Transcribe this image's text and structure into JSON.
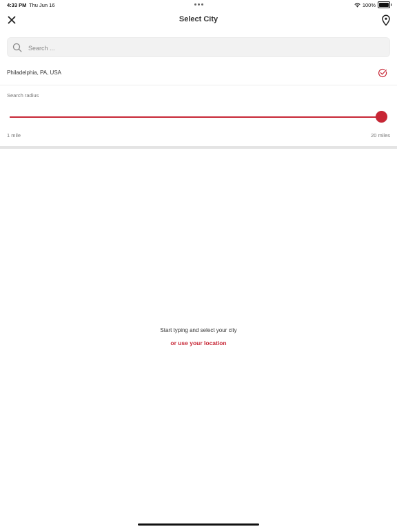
{
  "status_bar": {
    "time": "4:33 PM",
    "date": "Thu Jun 16",
    "battery": "100%"
  },
  "header": {
    "title": "Select City",
    "close_icon": "close-icon",
    "location_icon": "location-pin-icon"
  },
  "search": {
    "placeholder": "Search ...",
    "value": "",
    "icon": "search-icon"
  },
  "selected_city": {
    "name": "Philadelphia, PA, USA",
    "selected": true,
    "icon": "check-circle-icon"
  },
  "radius": {
    "label": "Search radius",
    "min_label": "1 mile",
    "max_label": "20 miles",
    "min": 1,
    "max": 20,
    "value": 20
  },
  "empty_state": {
    "hint": "Start typing and select your city",
    "link": "or use your location"
  },
  "colors": {
    "accent": "#c72635",
    "search_bg": "#f2f2f2",
    "divider": "#e4e4e4"
  }
}
